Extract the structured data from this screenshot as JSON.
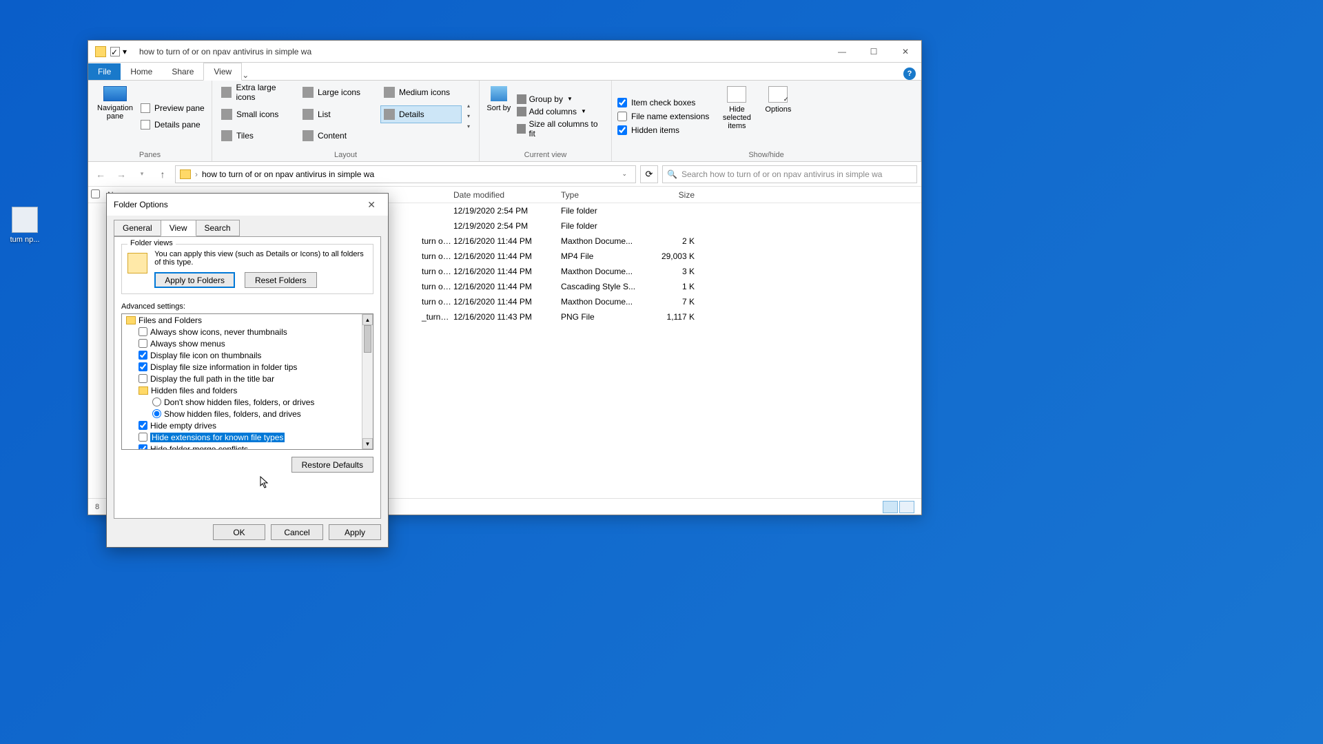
{
  "desktop": {
    "icon_label": "tum\nnp..."
  },
  "window": {
    "title": "how to turn of or on npav antivirus  in simple  wa",
    "tabs": {
      "file": "File",
      "home": "Home",
      "share": "Share",
      "view": "View"
    },
    "ribbon": {
      "panes": {
        "label": "Panes",
        "nav": "Navigation pane",
        "preview": "Preview pane",
        "details": "Details pane"
      },
      "layout": {
        "label": "Layout",
        "items": [
          "Extra large icons",
          "Large icons",
          "Medium icons",
          "Small icons",
          "List",
          "Details",
          "Tiles",
          "Content"
        ]
      },
      "current_view": {
        "label": "Current view",
        "sort": "Sort by",
        "group": "Group by",
        "add_cols": "Add columns",
        "size_cols": "Size all columns to fit"
      },
      "show_hide": {
        "label": "Show/hide",
        "item_check": "Item check boxes",
        "fn_ext": "File name extensions",
        "hidden": "Hidden items",
        "hide_sel": "Hide selected items",
        "options": "Options"
      }
    },
    "address": {
      "path": "how to turn of or on npav antivirus  in simple  wa"
    },
    "search": {
      "placeholder": "Search how to turn of or on npav antivirus  in simple  wa"
    },
    "columns": {
      "name": "Name",
      "date": "Date modified",
      "type": "Type",
      "size": "Size"
    },
    "rows": [
      {
        "name": "",
        "date": "12/19/2020 2:54 PM",
        "type": "File folder",
        "size": ""
      },
      {
        "name": "",
        "date": "12/19/2020 2:54 PM",
        "type": "File folder",
        "size": ""
      },
      {
        "name": "turn of or on npav antivirus  in simple  wa",
        "date": "12/16/2020 11:44 PM",
        "type": "Maxthon Docume...",
        "size": "2 K"
      },
      {
        "name": "turn of or on npav antivirus  in simple  wa",
        "date": "12/16/2020 11:44 PM",
        "type": "MP4 File",
        "size": "29,003 K"
      },
      {
        "name": "turn of or on npav antivirus  in simple  wa_config",
        "date": "12/16/2020 11:44 PM",
        "type": "Maxthon Docume...",
        "size": "3 K"
      },
      {
        "name": "turn of or on npav antivirus  in simple  wa_embed",
        "date": "12/16/2020 11:44 PM",
        "type": "Cascading Style S...",
        "size": "1 K"
      },
      {
        "name": "turn of or on npav antivirus  in simple  wa_player",
        "date": "12/16/2020 11:44 PM",
        "type": "Maxthon Docume...",
        "size": "7 K"
      },
      {
        "name": "_turn_of_or_on_npav_antivirus__in_simple__wa_First_Frame",
        "date": "12/16/2020 11:43 PM",
        "type": "PNG File",
        "size": "1,117 K"
      }
    ],
    "status": {
      "count": "8"
    }
  },
  "dialog": {
    "title": "Folder Options",
    "tabs": {
      "general": "General",
      "view": "View",
      "search": "Search"
    },
    "folder_views": {
      "legend": "Folder views",
      "text": "You can apply this view (such as Details or Icons) to all folders of this type.",
      "apply": "Apply to Folders",
      "reset": "Reset Folders"
    },
    "advanced_label": "Advanced settings:",
    "tree": {
      "root": "Files and Folders",
      "n0": "Always show icons, never thumbnails",
      "n1": "Always show menus",
      "n2": "Display file icon on thumbnails",
      "n3": "Display file size information in folder tips",
      "n4": "Display the full path in the title bar",
      "n5": "Hidden files and folders",
      "r0": "Don't show hidden files, folders, or drives",
      "r1": "Show hidden files, folders, and drives",
      "n6": "Hide empty drives",
      "n7": "Hide extensions for known file types",
      "n8": "Hide folder merge conflicts"
    },
    "restore": "Restore Defaults",
    "buttons": {
      "ok": "OK",
      "cancel": "Cancel",
      "apply": "Apply"
    }
  }
}
